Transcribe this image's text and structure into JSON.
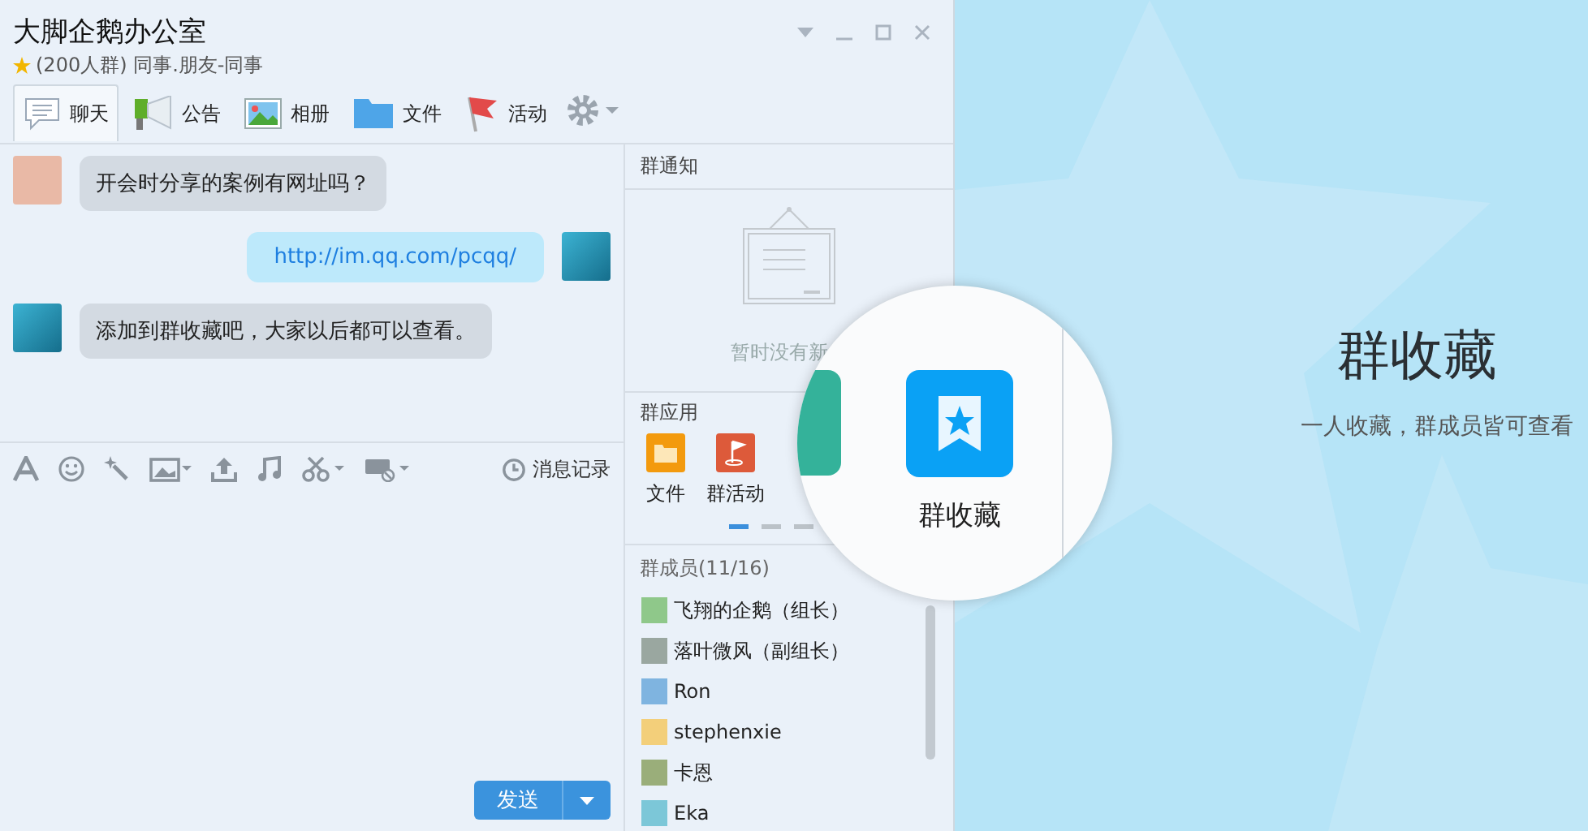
{
  "window": {
    "title": "大脚企鹅办公室",
    "subtitle": "(200人群) 同事.朋友-同事"
  },
  "tabs": [
    {
      "kind": "chat",
      "label": "聊天",
      "selected": true
    },
    {
      "kind": "notice",
      "label": "公告",
      "selected": false
    },
    {
      "kind": "album",
      "label": "相册",
      "selected": false
    },
    {
      "kind": "file",
      "label": "文件",
      "selected": false
    },
    {
      "kind": "event",
      "label": "活动",
      "selected": false
    },
    {
      "kind": "settings"
    }
  ],
  "messages": [
    {
      "kind": "received",
      "text": "开会时分享的案例有网址吗？"
    },
    {
      "kind": "sent",
      "text": "http://im.qq.com/pcqq/"
    },
    {
      "kind": "received",
      "text": "添加到群收藏吧，大家以后都可以查看。"
    }
  ],
  "history": "消息记录",
  "send_button": "发送",
  "notice": {
    "title": "群通知",
    "empty_text": "暂时没有新"
  },
  "apps": {
    "title": "群应用",
    "items": [
      {
        "kind": "folder",
        "label": "文件"
      },
      {
        "kind": "event",
        "label": "群活动"
      }
    ],
    "pages": [
      {
        "selected": true
      },
      {
        "selected": false
      },
      {
        "selected": false
      }
    ]
  },
  "members": {
    "title": "群成员(11/16)",
    "items": [
      {
        "name": "飞翔的企鹅（组长）"
      },
      {
        "name": "落叶微风（副组长）"
      },
      {
        "name": "Ron"
      },
      {
        "name": "stephenxie"
      },
      {
        "name": "卡恩"
      },
      {
        "name": "Eka"
      }
    ]
  },
  "magnifier": {
    "label": "群收藏"
  },
  "promo": {
    "title": "群收藏",
    "subtitle": "一人收藏，群成员皆可查看"
  }
}
